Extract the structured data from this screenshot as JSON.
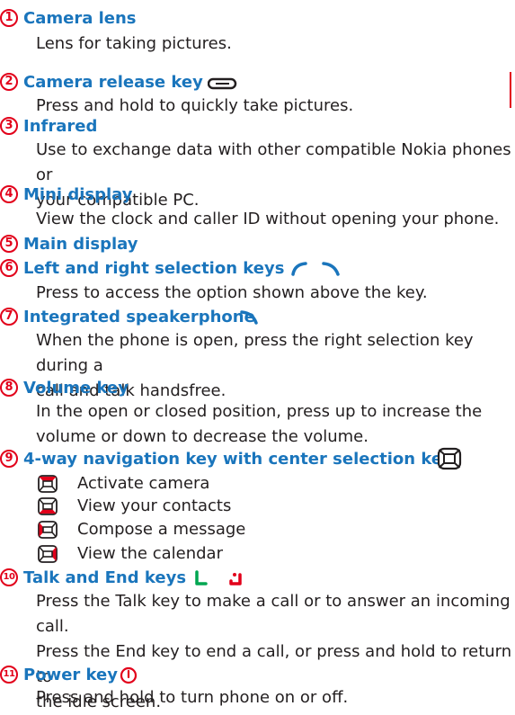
{
  "items": [
    {
      "num": "1",
      "title": "Camera lens",
      "body": [
        "Lens for taking pictures."
      ]
    },
    {
      "num": "2",
      "title": "Camera release key",
      "body": [
        "Press and hold to quickly take pictures."
      ],
      "icon": "camera-release-icon"
    },
    {
      "num": "3",
      "title": "Infrared",
      "body": [
        "Use to exchange data with other compatible Nokia phones or",
        "your compatible PC."
      ]
    },
    {
      "num": "4",
      "title": "Mini display",
      "body": [
        "View the clock and caller ID without opening your phone."
      ]
    },
    {
      "num": "5",
      "title": "Main display",
      "body": []
    },
    {
      "num": "6",
      "title": "Left and right selection keys",
      "body": [
        "Press to access the option shown above the key."
      ],
      "icon": "selection-keys-icon"
    },
    {
      "num": "7",
      "title": "Integrated speakerphone",
      "body": [
        "When the phone is open, press the right selection key during a",
        "call and talk handsfree."
      ],
      "icon": "right-selection-key-icon"
    },
    {
      "num": "8",
      "title": "Volume key",
      "body": [
        "In the open or closed position, press up to increase the",
        "volume or down to decrease the volume."
      ]
    },
    {
      "num": "9",
      "title": "4-way navigation key with center selection key",
      "icon": "navigation-key-icon",
      "subitems": [
        {
          "label": "Activate camera",
          "icon": "nav-up-icon"
        },
        {
          "label": "View your contacts",
          "icon": "nav-down-icon"
        },
        {
          "label": "Compose a message",
          "icon": "nav-left-icon"
        },
        {
          "label": "View the calendar",
          "icon": "nav-right-icon"
        }
      ]
    },
    {
      "num": "10",
      "title": "Talk and End keys",
      "body": [
        "Press the Talk key to make a call or to answer an incoming call.",
        "Press the End key to end a call, or press and hold to return to",
        "the idle screen."
      ],
      "icon": "talk-end-keys-icon"
    },
    {
      "num": "11",
      "title": "Power key",
      "body": [
        "Press and hold to turn phone on or off."
      ],
      "icon": "power-icon"
    }
  ],
  "colors": {
    "number": "#e2001a",
    "title": "#1a75bc",
    "text": "#231f20",
    "talk": "#00a651",
    "end": "#e2001a"
  }
}
